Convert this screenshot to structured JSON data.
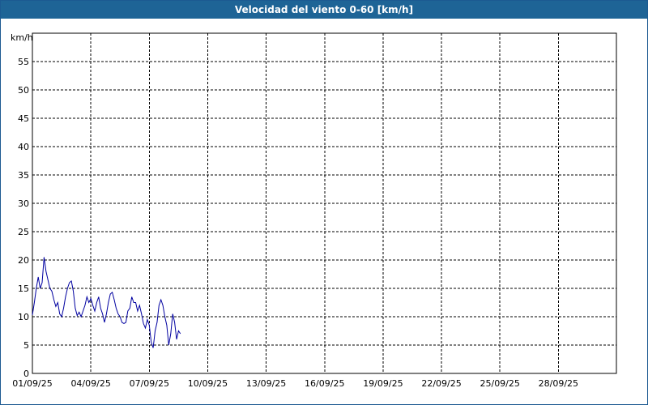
{
  "window": {
    "title": "Velocidad del viento 0-60 [km/h]"
  },
  "chart_data": {
    "type": "line",
    "title": "Velocidad del viento 0-60 [km/h]",
    "ylabel": "km/h",
    "xlabel": "",
    "ylim": [
      0,
      60
    ],
    "yticks": [
      0,
      5,
      10,
      15,
      20,
      25,
      30,
      35,
      40,
      45,
      50,
      55
    ],
    "xticks": [
      "01/09/25",
      "04/09/25",
      "07/09/25",
      "10/09/25",
      "13/09/25",
      "16/09/25",
      "19/09/25",
      "22/09/25",
      "25/09/25",
      "28/09/25"
    ],
    "xlim_days": [
      0,
      30
    ],
    "grid": true,
    "series_color": "#0000a0",
    "series": [
      {
        "values": [
          [
            0.0,
            10.3
          ],
          [
            0.1,
            12.5
          ],
          [
            0.2,
            15.0
          ],
          [
            0.3,
            17.0
          ],
          [
            0.4,
            15.0
          ],
          [
            0.5,
            16.0
          ],
          [
            0.6,
            20.5
          ],
          [
            0.7,
            18.0
          ],
          [
            0.8,
            16.5
          ],
          [
            0.9,
            15.0
          ],
          [
            1.0,
            14.5
          ],
          [
            1.1,
            13.0
          ],
          [
            1.2,
            11.8
          ],
          [
            1.3,
            12.5
          ],
          [
            1.4,
            10.5
          ],
          [
            1.5,
            10.0
          ],
          [
            1.6,
            11.5
          ],
          [
            1.7,
            13.5
          ],
          [
            1.8,
            15.0
          ],
          [
            1.9,
            16.0
          ],
          [
            2.0,
            16.3
          ],
          [
            2.1,
            14.5
          ],
          [
            2.2,
            11.5
          ],
          [
            2.3,
            10.2
          ],
          [
            2.4,
            10.8
          ],
          [
            2.5,
            10.0
          ],
          [
            2.6,
            11.0
          ],
          [
            2.7,
            12.0
          ],
          [
            2.8,
            13.5
          ],
          [
            2.9,
            12.5
          ],
          [
            3.0,
            13.2
          ],
          [
            3.1,
            12.0
          ],
          [
            3.2,
            11.0
          ],
          [
            3.3,
            12.5
          ],
          [
            3.4,
            13.5
          ],
          [
            3.5,
            11.5
          ],
          [
            3.6,
            10.5
          ],
          [
            3.7,
            9.0
          ],
          [
            3.8,
            10.5
          ],
          [
            3.9,
            12.5
          ],
          [
            4.0,
            14.0
          ],
          [
            4.1,
            14.3
          ],
          [
            4.2,
            13.0
          ],
          [
            4.3,
            11.5
          ],
          [
            4.4,
            10.5
          ],
          [
            4.5,
            10.0
          ],
          [
            4.6,
            9.0
          ],
          [
            4.7,
            8.8
          ],
          [
            4.8,
            9.0
          ],
          [
            4.9,
            11.0
          ],
          [
            5.0,
            11.5
          ],
          [
            5.1,
            13.5
          ],
          [
            5.2,
            12.5
          ],
          [
            5.3,
            12.5
          ],
          [
            5.4,
            11.0
          ],
          [
            5.5,
            12.0
          ],
          [
            5.6,
            10.5
          ],
          [
            5.7,
            8.8
          ],
          [
            5.8,
            8.0
          ],
          [
            5.9,
            9.5
          ],
          [
            6.0,
            8.5
          ],
          [
            6.1,
            5.5
          ],
          [
            6.2,
            4.5
          ],
          [
            6.3,
            7.5
          ],
          [
            6.4,
            9.0
          ],
          [
            6.5,
            12.0
          ],
          [
            6.6,
            13.0
          ],
          [
            6.7,
            12.0
          ],
          [
            6.8,
            10.0
          ],
          [
            6.9,
            8.5
          ],
          [
            7.0,
            5.0
          ],
          [
            7.1,
            7.0
          ],
          [
            7.2,
            10.5
          ],
          [
            7.3,
            9.0
          ],
          [
            7.4,
            6.0
          ],
          [
            7.5,
            7.5
          ],
          [
            7.6,
            7.0
          ]
        ]
      }
    ]
  }
}
